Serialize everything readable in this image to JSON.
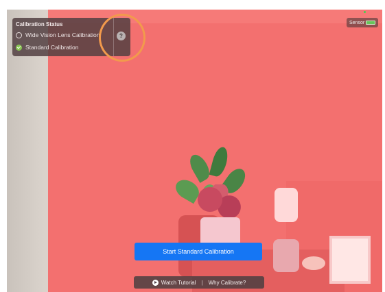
{
  "colors": {
    "accent": "#1576f4",
    "overlay_red": "#f3706f",
    "status_green": "#8ac554",
    "highlight_orange": "#f29a4c"
  },
  "header": {
    "sensor_label": "Sensor",
    "battery_icon": "battery-icon"
  },
  "calibration_panel": {
    "title": "Calibration Status",
    "items": [
      {
        "label": "Wide Vision Lens Calibration",
        "status": "pending",
        "icon": "pending-ring-icon"
      },
      {
        "label": "Standard Calibration",
        "status": "complete",
        "icon": "check-circle-icon"
      }
    ],
    "help_label": "?"
  },
  "main": {
    "start_button_label": "Start Standard Calibration"
  },
  "footer": {
    "watch_tutorial_label": "Watch Tutorial",
    "separator": "|",
    "why_calibrate_label": "Why Calibrate?"
  }
}
